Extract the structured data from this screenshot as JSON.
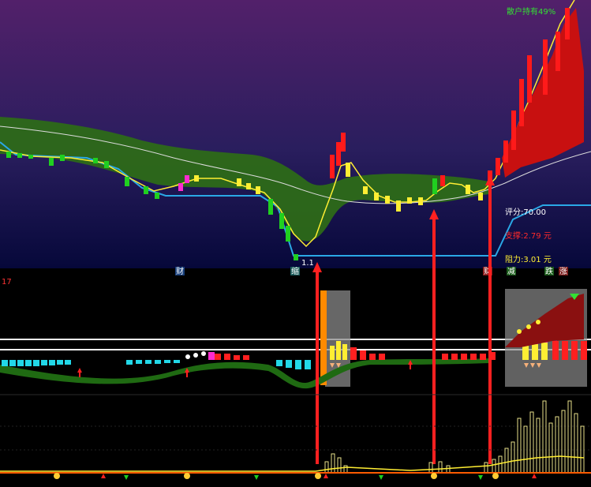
{
  "panel_top": {
    "retail_holding": "散户持有49%",
    "score": "评分:70.00",
    "support": "支撑:2.79 元",
    "resistance": "阻力:3.01 元",
    "low_marker": "1.1",
    "tags": [
      "财",
      "缩",
      "财",
      "减",
      "跌",
      "涨"
    ]
  },
  "panel_mid": {
    "label": "17"
  },
  "colors": {
    "bg_top": "#4b1d63",
    "bg_bottom": "#050a3a",
    "cloud": "#2f6b1a",
    "cloud_dark": "#1f4f14",
    "cyan": "#2aa8e6",
    "yellow": "#ffee33",
    "white_line": "#e8e8e8",
    "red": "#ff1a1a",
    "dark_red": "#b30f0f",
    "green": "#1fd11f",
    "magenta": "#ff2bd0",
    "orange": "#ff8a00",
    "score_color": "#ffffff",
    "support_color": "#ff2a2a",
    "resistance_color": "#ffee33",
    "holding_color": "#33e033"
  },
  "icons": [
    "arrow-up-icon",
    "arrow-down-icon",
    "dollar-coin-icon",
    "diamond-icon"
  ]
}
